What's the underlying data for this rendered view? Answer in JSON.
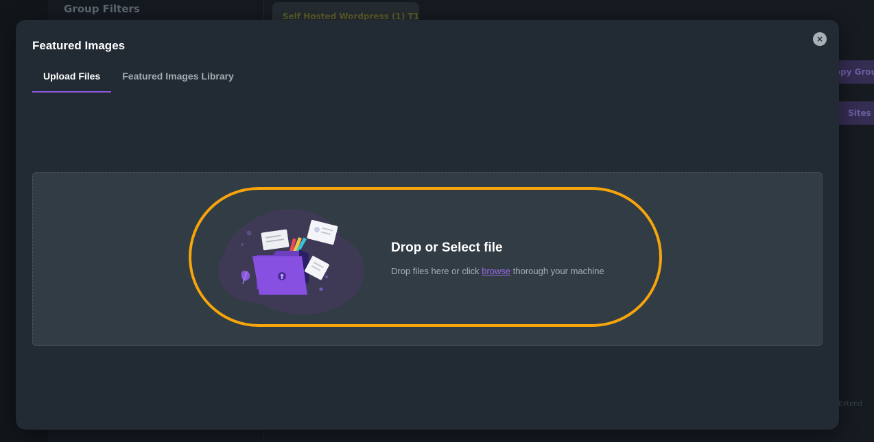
{
  "background": {
    "group_filters": "Group Filters",
    "top_pill": "Self Hosted Wordpress (1) T1",
    "right_button_1": "Copy Group",
    "right_button_2": "Sites T",
    "right_small_text": "Extend"
  },
  "modal": {
    "title": "Featured Images",
    "close_icon": "close-icon",
    "tabs": [
      {
        "label": "Upload Files",
        "active": true
      },
      {
        "label": "Featured Images Library",
        "active": false
      }
    ],
    "dropzone": {
      "title": "Drop or Select file",
      "desc_before": "Drop files here or click",
      "browse_link": "browse",
      "desc_after": "thorough your machine",
      "illustration": "upload-folder-illustration"
    }
  },
  "colors": {
    "accent": "#8e59e0",
    "highlight": "#f7a50b",
    "modal_bg": "#222a33",
    "dropzone_bg": "#323c45"
  }
}
